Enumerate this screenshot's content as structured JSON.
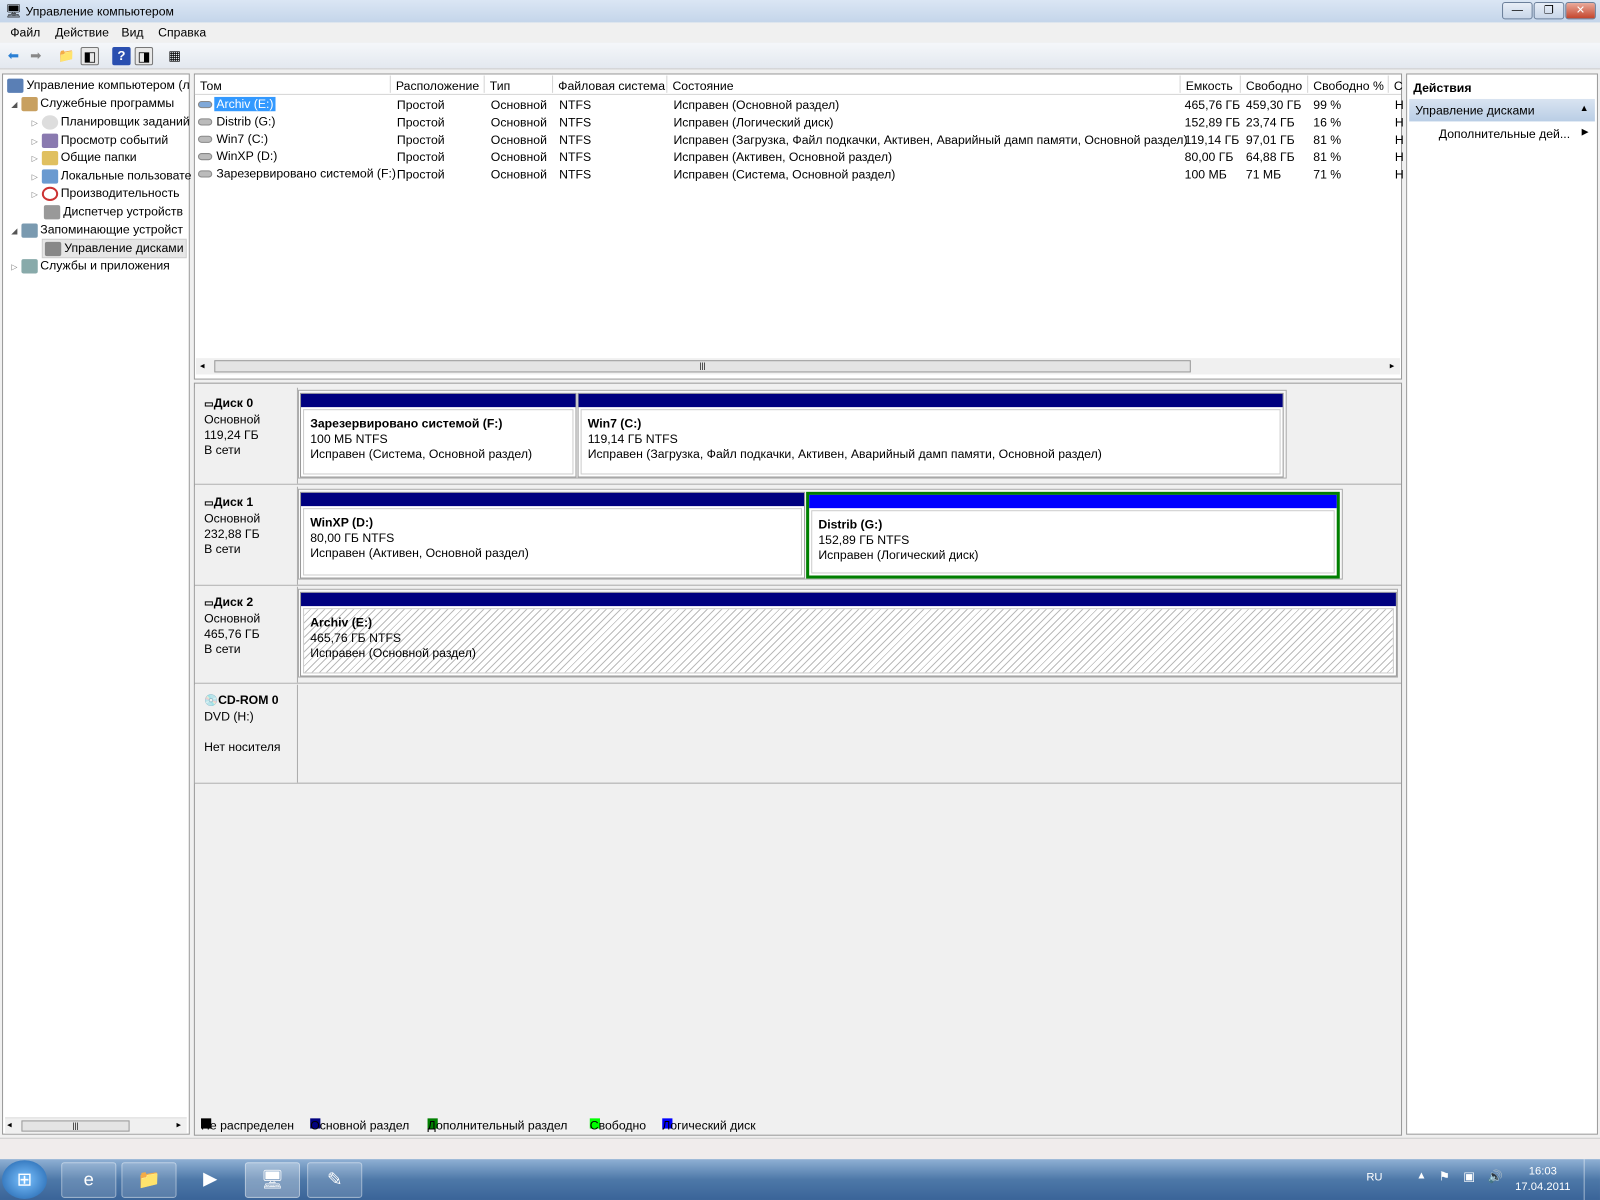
{
  "window": {
    "title": "Управление компьютером",
    "minimize": "—",
    "maximize": "❐",
    "close": "✕"
  },
  "menu": [
    "Файл",
    "Действие",
    "Вид",
    "Справка"
  ],
  "tree": {
    "root": "Управление компьютером (л",
    "items": [
      {
        "label": "Служебные программы",
        "expander": "◢"
      },
      {
        "label": "Планировщик заданий",
        "expander": "▷"
      },
      {
        "label": "Просмотр событий",
        "expander": "▷"
      },
      {
        "label": "Общие папки",
        "expander": "▷"
      },
      {
        "label": "Локальные пользовате",
        "expander": "▷"
      },
      {
        "label": "Производительность",
        "expander": "▷"
      },
      {
        "label": "Диспетчер устройств",
        "expander": ""
      },
      {
        "label": "Запоминающие устройст",
        "expander": "◢"
      },
      {
        "label": "Управление дисками",
        "expander": "",
        "selected": true
      },
      {
        "label": "Службы и приложения",
        "expander": "▷"
      }
    ]
  },
  "table": {
    "columns": [
      "Том",
      "Расположение",
      "Тип",
      "Файловая система",
      "Состояние",
      "Емкость",
      "Свободно",
      "Свободно %",
      "С"
    ],
    "rows": [
      [
        "Archiv (E:)",
        "Простой",
        "Основной",
        "NTFS",
        "Исправен (Основной раздел)",
        "465,76 ГБ",
        "459,30 ГБ",
        "99 %",
        "Н"
      ],
      [
        "Distrib (G:)",
        "Простой",
        "Основной",
        "NTFS",
        "Исправен (Логический диск)",
        "152,89 ГБ",
        "23,74 ГБ",
        "16 %",
        "Н"
      ],
      [
        "Win7 (C:)",
        "Простой",
        "Основной",
        "NTFS",
        "Исправен (Загрузка, Файл подкачки, Активен, Аварийный дамп памяти, Основной раздел)",
        "119,14 ГБ",
        "97,01 ГБ",
        "81 %",
        "Н"
      ],
      [
        "WinXP (D:)",
        "Простой",
        "Основной",
        "NTFS",
        "Исправен (Активен, Основной раздел)",
        "80,00 ГБ",
        "64,88 ГБ",
        "81 %",
        "Н"
      ],
      [
        "Зарезервировано системой (F:)",
        "Простой",
        "Основной",
        "NTFS",
        "Исправен (Система, Основной раздел)",
        "100 МБ",
        "71 МБ",
        "71 %",
        "Н"
      ]
    ]
  },
  "disks": [
    {
      "name": "Диск 0",
      "type": "Основной",
      "size": "119,24 ГБ",
      "status": "В сети",
      "parts": [
        {
          "title": "Зарезервировано системой  (F:)",
          "size": "100 МБ NTFS",
          "state": "Исправен (Система, Основной раздел)"
        },
        {
          "title": "Win7  (C:)",
          "size": "119,14 ГБ NTFS",
          "state": "Исправен (Загрузка, Файл подкачки, Активен, Аварийный дамп памяти, Основной раздел)"
        }
      ]
    },
    {
      "name": "Диск 1",
      "type": "Основной",
      "size": "232,88 ГБ",
      "status": "В сети",
      "parts": [
        {
          "title": "WinXP  (D:)",
          "size": "80,00 ГБ NTFS",
          "state": "Исправен (Активен, Основной раздел)"
        },
        {
          "title": "Distrib  (G:)",
          "size": "152,89 ГБ NTFS",
          "state": "Исправен (Логический диск)"
        }
      ]
    },
    {
      "name": "Диск 2",
      "type": "Основной",
      "size": "465,76 ГБ",
      "status": "В сети",
      "parts": [
        {
          "title": "Archiv  (E:)",
          "size": "465,76 ГБ NTFS",
          "state": "Исправен (Основной раздел)"
        }
      ]
    }
  ],
  "cdrom": {
    "name": "CD-ROM 0",
    "type": "DVD (H:)",
    "status": "Нет носителя"
  },
  "legend": [
    {
      "label": "Не распределен",
      "color": "#000000"
    },
    {
      "label": "Основной раздел",
      "color": "#00007f"
    },
    {
      "label": "Дополнительный раздел",
      "color": "#007f00"
    },
    {
      "label": "Свободно",
      "color": "#00ff00"
    },
    {
      "label": "Логический диск",
      "color": "#0000ff"
    }
  ],
  "actions": {
    "title": "Действия",
    "section": "Управление дисками",
    "more": "Дополнительные дей..."
  },
  "tray": {
    "lang": "RU",
    "time": "16:03",
    "date": "17.04.2011"
  }
}
